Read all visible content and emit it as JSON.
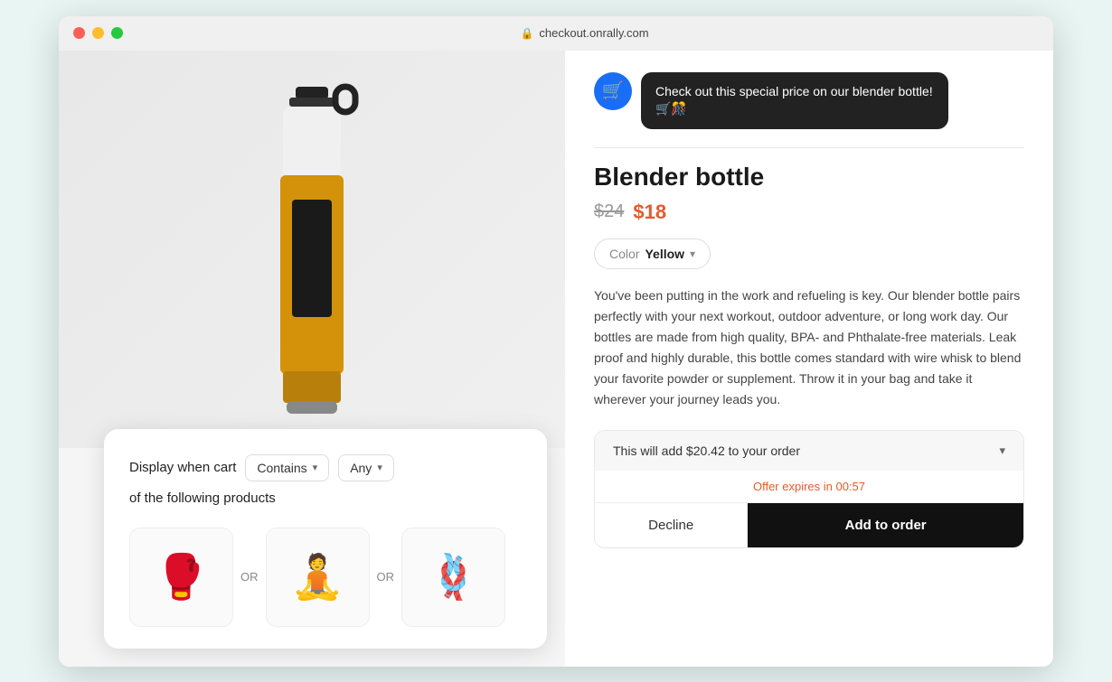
{
  "browser": {
    "url": "checkout.onrally.com"
  },
  "chat": {
    "message": "Check out this special price on our blender bottle! 🛒🎊"
  },
  "product": {
    "title": "Blender bottle",
    "price_original": "$24",
    "price_sale": "$18",
    "color_label": "Color",
    "color_value": "Yellow",
    "description": "You've been putting in the work and refueling is key. Our blender bottle pairs perfectly with your next workout, outdoor adventure, or long work day. Our bottles are made from high quality, BPA- and Phthalate-free materials. Leak proof and highly durable, this bottle comes standard with wire whisk to blend your favorite powder or supplement. Throw it in your bag and take it wherever your journey leads you."
  },
  "order": {
    "summary_text": "This will add $20.42 to your order",
    "expiry_text": "Offer expires in 00:57",
    "decline_label": "Decline",
    "add_label": "Add to order"
  },
  "cart_display": {
    "label": "Display when cart",
    "condition": "Contains",
    "quantity": "Any",
    "suffix": "of the following products"
  }
}
